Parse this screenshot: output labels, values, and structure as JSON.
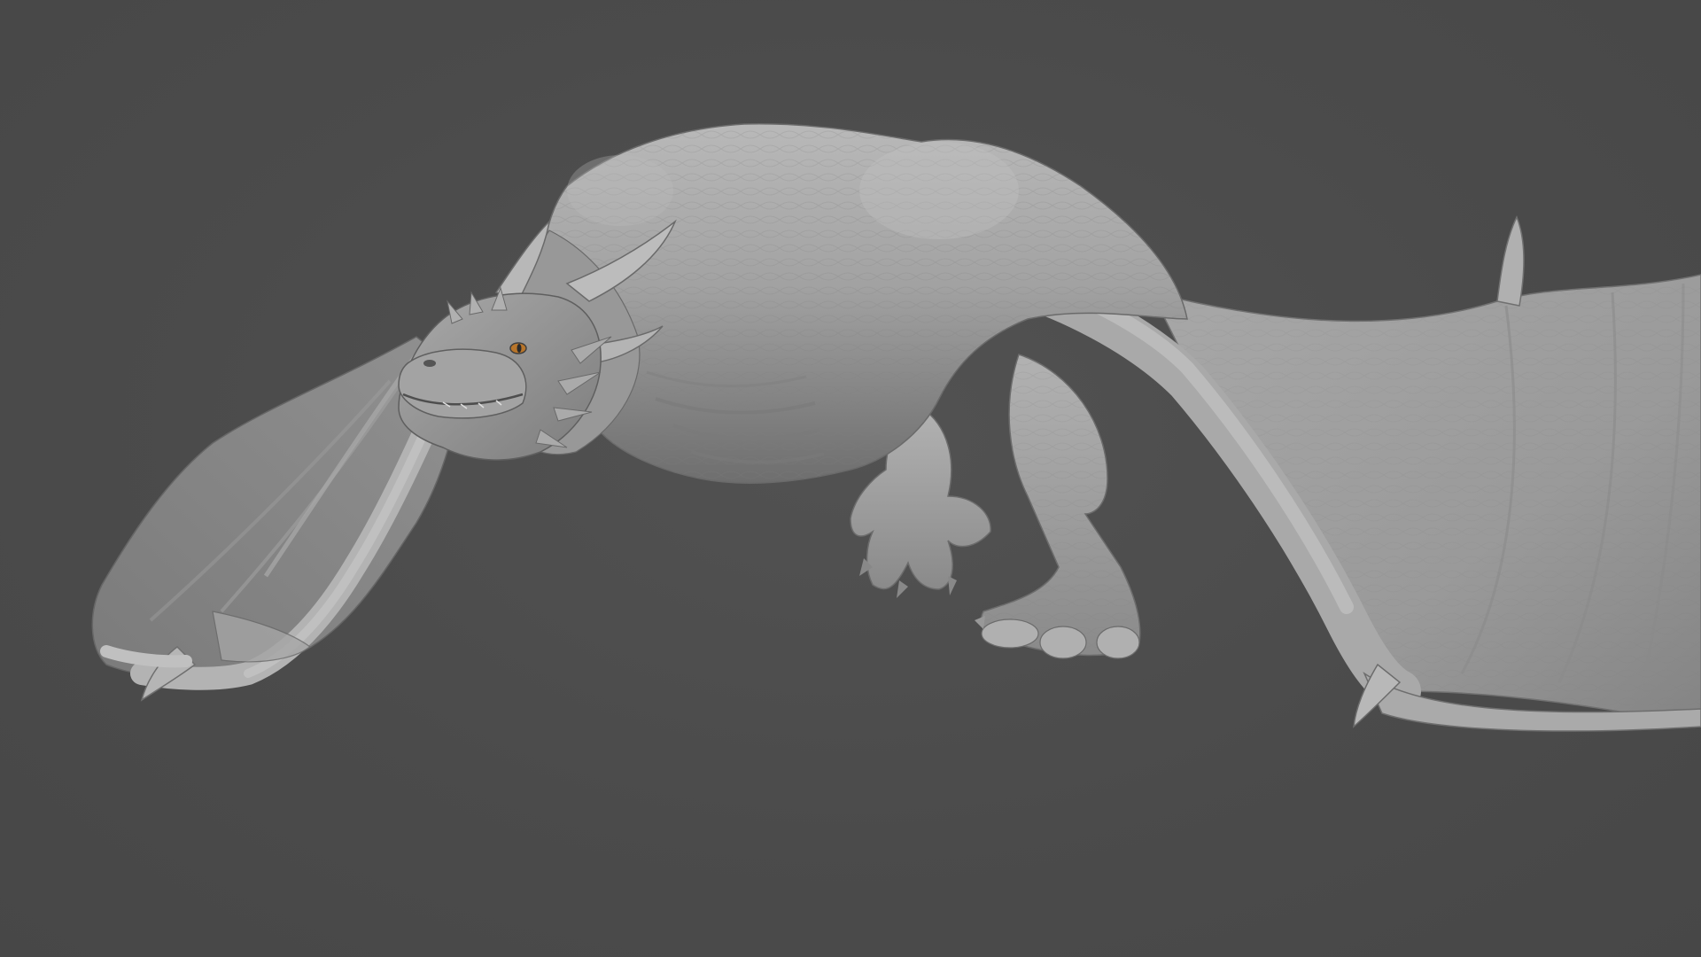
{
  "viewport": {
    "background_color": "#4b4b4b",
    "subject": "dragon-sculpt",
    "material": "clay-grey",
    "eye_color": "#b8752a"
  }
}
